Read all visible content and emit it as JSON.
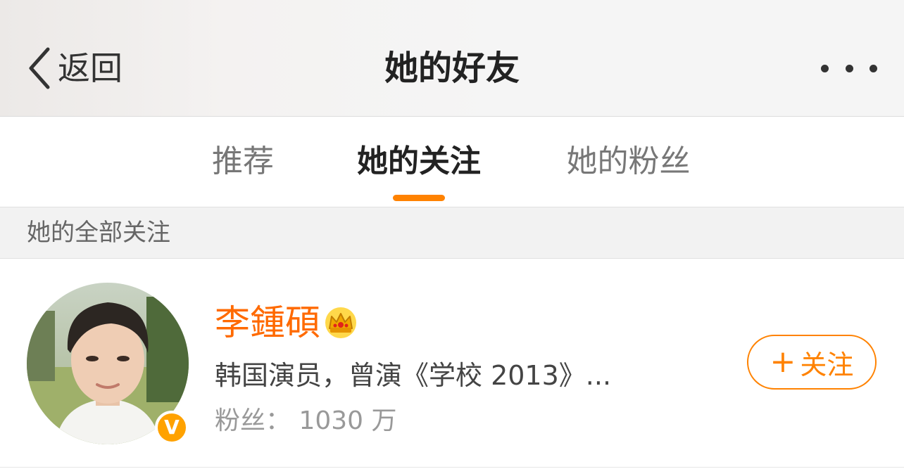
{
  "navbar": {
    "back_label": "返回",
    "title": "她的好友"
  },
  "tabs": [
    {
      "label": "推荐",
      "active": false
    },
    {
      "label": "她的关注",
      "active": true
    },
    {
      "label": "她的粉丝",
      "active": false
    }
  ],
  "section": {
    "title": "她的全部关注"
  },
  "users": [
    {
      "name": "李鍾碩",
      "description": "韩国演员，曾演《学校 2013》...",
      "fans": "粉丝： 1030 万",
      "verified_mark": "V",
      "follow_label": "关注",
      "follow_prefix": "+"
    }
  ],
  "colors": {
    "accent": "#ff8200",
    "name": "#ff6a00",
    "verified": "#ffa200"
  },
  "icons": {
    "back": "chevron-left-icon",
    "more": "more-dots-icon",
    "crown": "crown-icon",
    "verified": "verified-badge-icon"
  }
}
